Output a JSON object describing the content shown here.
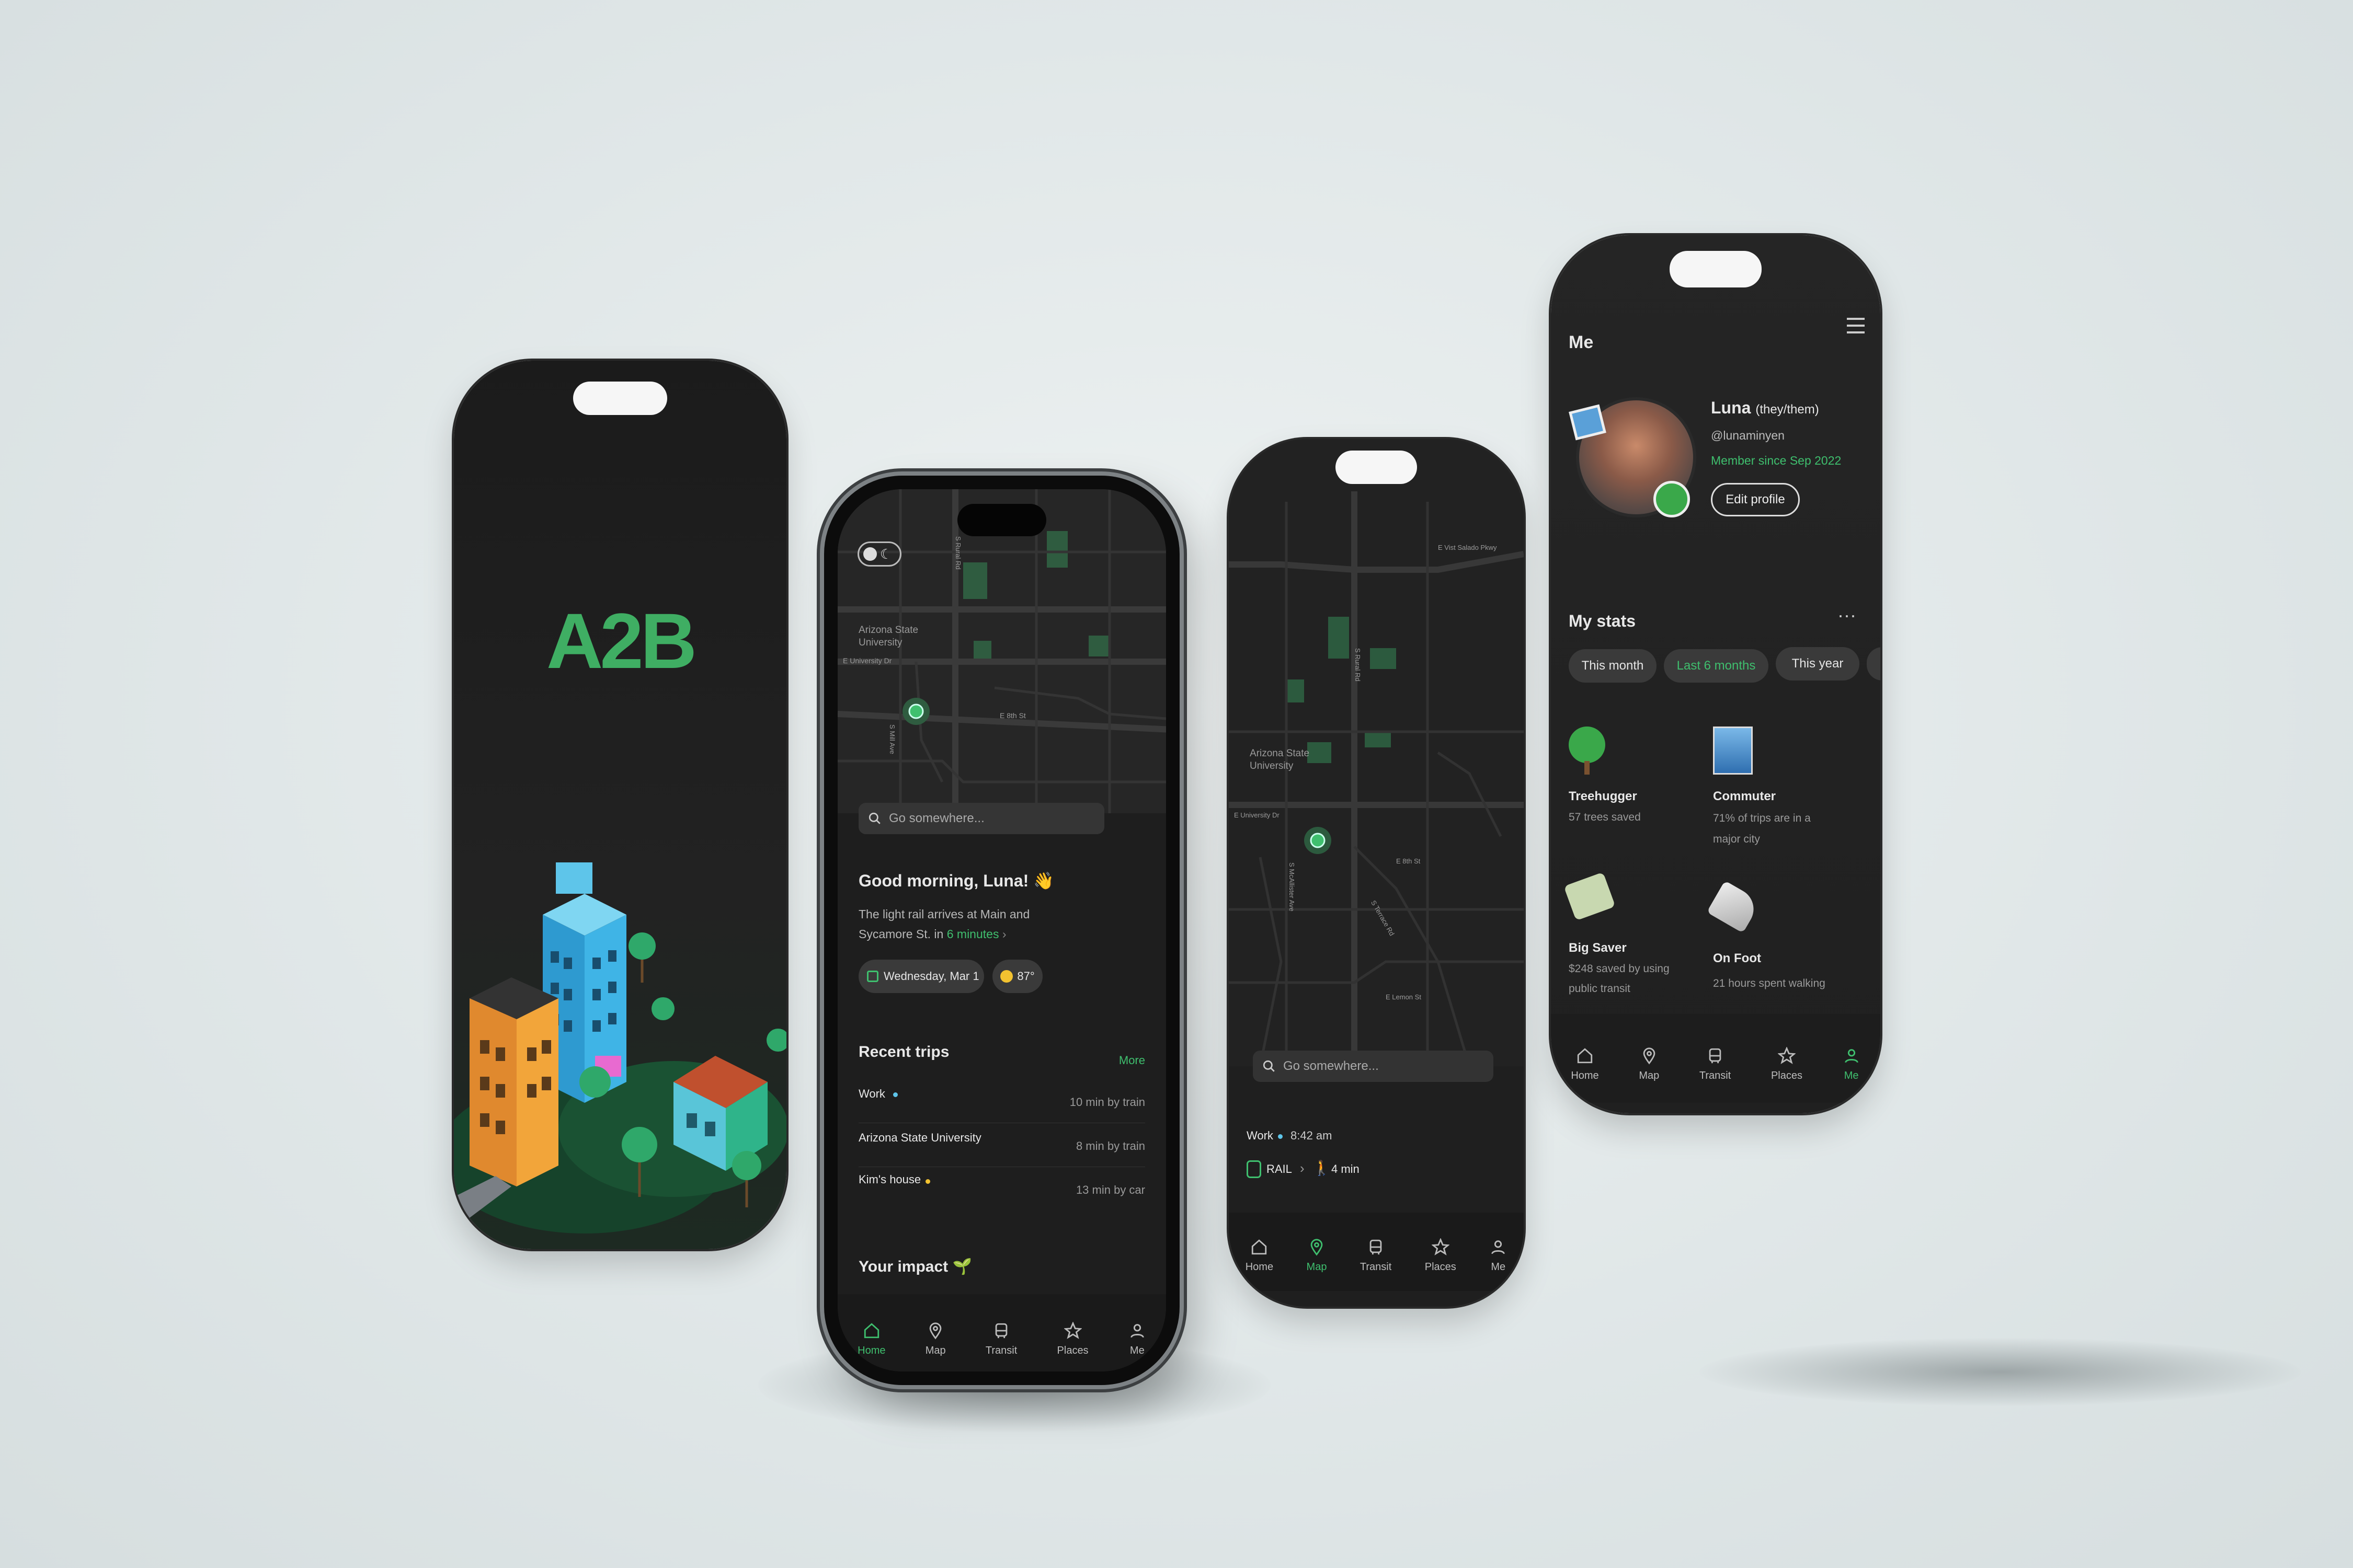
{
  "colors": {
    "accent": "#3fbf6e",
    "bg_dark": "#1d1d1d",
    "backdrop": "#e3e9ea"
  },
  "splash": {
    "logo": "A2B"
  },
  "home": {
    "map_labels": [
      "Arizona State University",
      "E University Dr",
      "S Rural Rd",
      "S Mill Ave",
      "E 8th St"
    ],
    "search_placeholder": "Go somewhere...",
    "greeting": "Good morning, Luna! 👋",
    "notice_line1": "The light rail arrives at Main and",
    "notice_line2_pre": "Sycamore St. in ",
    "notice_highlight": "6 minutes",
    "date": "Wednesday, Mar 1",
    "temp": "87°",
    "recent_title": "Recent trips",
    "more": "More",
    "trips": [
      {
        "name": "Work",
        "detail": "10 min by train"
      },
      {
        "name": "Arizona State University",
        "detail": "8 min by train"
      },
      {
        "name": "Kim's house",
        "detail": "13 min by car"
      }
    ],
    "impact_title": "Your impact 🌱"
  },
  "map": {
    "map_labels": [
      "E Vist Salado Pkwy",
      "S Rural Rd",
      "Arizona State University",
      "E University Dr",
      "E 8th St",
      "S McAllister Ave",
      "S Terrace Rd",
      "E Lemon St"
    ],
    "search_placeholder": "Go somewhere...",
    "trip_name": "Work",
    "trip_time": "8:42 am",
    "mode": "RAIL",
    "walk": "4 min"
  },
  "me": {
    "title": "Me",
    "name": "Luna",
    "pronouns": "(they/them)",
    "handle": "@lunaminyen",
    "member_since": "Member since Sep 2022",
    "edit_profile": "Edit profile",
    "stats_title": "My stats",
    "filters": [
      "This month",
      "Last 6 months",
      "This year"
    ],
    "badges": [
      {
        "title": "Treehugger",
        "line1": "57 trees saved",
        "line2": ""
      },
      {
        "title": "Commuter",
        "line1": "71% of trips are in a",
        "line2": "major city"
      },
      {
        "title": "Big Saver",
        "line1": "$248 saved by using",
        "line2": "public transit"
      },
      {
        "title": "On Foot",
        "line1": "21 hours spent walking",
        "line2": ""
      }
    ]
  },
  "nav": {
    "home": "Home",
    "map": "Map",
    "transit": "Transit",
    "places": "Places",
    "me": "Me"
  }
}
